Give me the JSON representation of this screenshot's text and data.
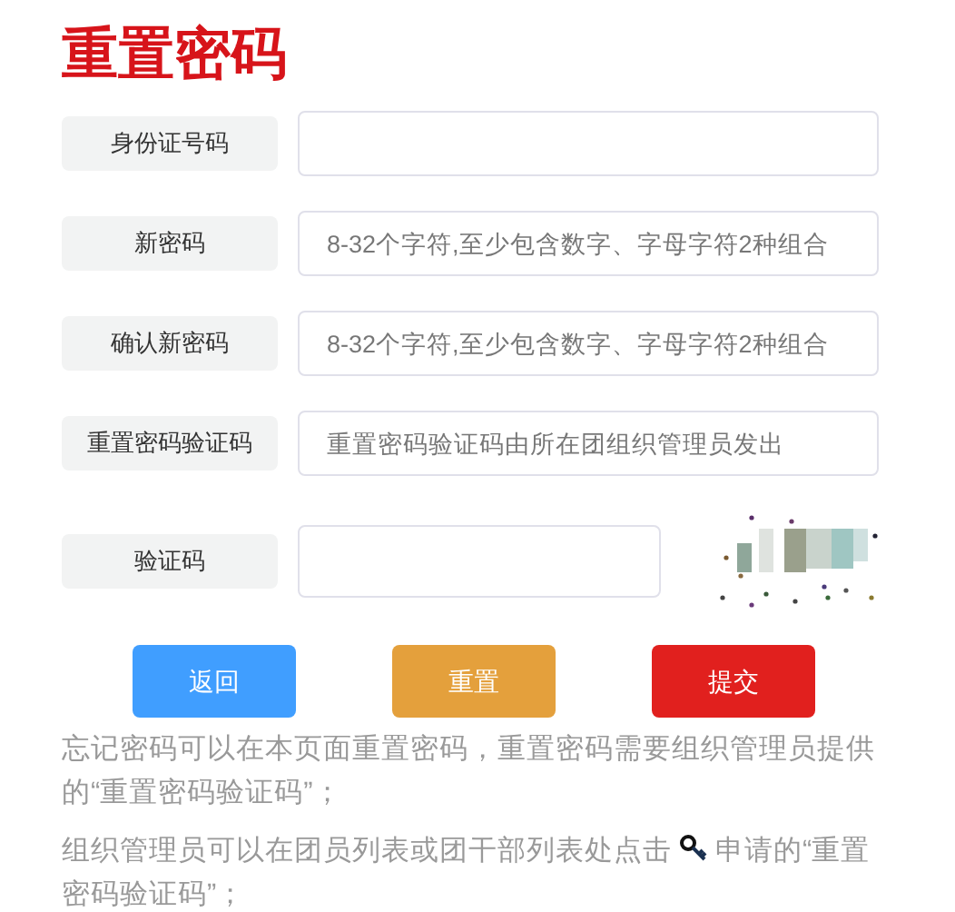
{
  "title": "重置密码",
  "fields": [
    {
      "label": "身份证号码"
    },
    {
      "label": "新密码",
      "placeholder": "8-32个字符,至少包含数字、字母字符2种组合"
    },
    {
      "label": "确认新密码",
      "placeholder": "8-32个字符,至少包含数字、字母字符2种组合"
    },
    {
      "label": "重置密码验证码",
      "placeholder": "重置密码验证码由所在团组织管理员发出"
    },
    {
      "label": "验证码",
      "kind": "captcha"
    }
  ],
  "buttons": [
    {
      "label": "返回",
      "color": "#409eff"
    },
    {
      "label": "重置",
      "color": "#e4a03c"
    },
    {
      "label": "提交",
      "color": "#e1201e"
    }
  ],
  "notes": [
    {
      "before": "忘记密码可以在本页面重置密码，重置密码需要组织管理员提供的“重置密码验证码”；"
    },
    {
      "before": "组织管理员可以在团员列表或团干部列表处点击",
      "after": "申请的“重置密码验证码”；"
    }
  ]
}
